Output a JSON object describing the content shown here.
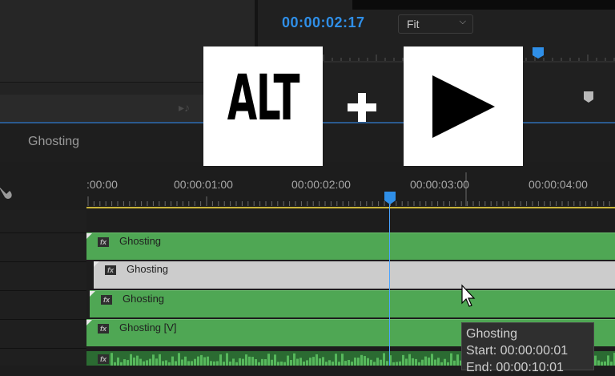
{
  "program_monitor": {
    "timecode": "00:00:02:17",
    "zoom_select": "Fit"
  },
  "sequence": {
    "tab_name": "Ghosting"
  },
  "ruler": {
    "timecodes": [
      ":00:00",
      "00:00:01:00",
      "00:00:02:00",
      "00:00:03:00",
      "00:00:04:00"
    ]
  },
  "tracks": [
    {
      "clip_name": "Ghosting",
      "state": "normal"
    },
    {
      "clip_name": "Ghosting",
      "state": "selected"
    },
    {
      "clip_name": "Ghosting",
      "state": "normal"
    },
    {
      "clip_name": "Ghosting [V]",
      "state": "normal"
    }
  ],
  "fx_badge": "fx",
  "tooltip": {
    "title": "Ghosting",
    "start": "Start: 00:00:00:01",
    "end": "End: 00:00:10:01"
  },
  "shortcut_overlay": {
    "key1": "ALT",
    "plus": "+",
    "key2_icon": "play-icon"
  },
  "colors": {
    "accent_blue": "#2f8fe8",
    "clip_green": "#4fa754",
    "clip_selected": "#cccccc",
    "work_area": "#c9b43a"
  }
}
